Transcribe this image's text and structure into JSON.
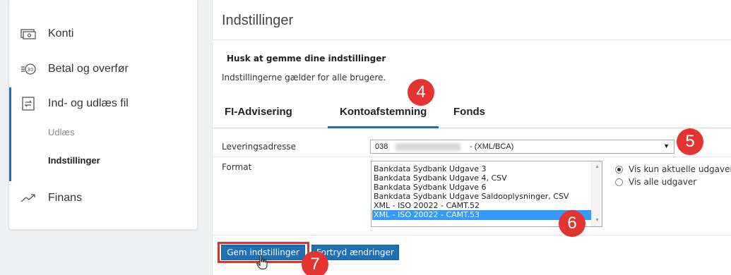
{
  "sidebar": {
    "items": [
      {
        "label": "Konti",
        "icon": "cash-icon"
      },
      {
        "label": "Betal og overfør",
        "icon": "coin-transfer-icon"
      },
      {
        "label": "Ind- og udlæs fil",
        "icon": "file-exchange-icon"
      },
      {
        "label": "Finans",
        "icon": "trend-icon"
      }
    ],
    "subitems": [
      {
        "label": "Udlæs"
      },
      {
        "label": "Indstillinger"
      }
    ]
  },
  "main": {
    "title": "Indstillinger",
    "notice_heading": "Husk at gemme dine indstillinger",
    "notice_text": "Indstillingerne gælder for alle brugere.",
    "tabs": [
      {
        "label": "FI-Advisering"
      },
      {
        "label": "Kontoafstemning"
      },
      {
        "label": "Fonds"
      }
    ],
    "form": {
      "delivery_label": "Leveringsadresse",
      "delivery_value_prefix": "038",
      "delivery_value_suffix": "- (XML/BCA)",
      "format_label": "Format",
      "format_options": [
        "Bankdata Sydbank Udgave 3",
        "Bankdata Sydbank Udgave 4, CSV",
        "Bankdata Sydbank Udgave 6",
        "Bankdata Sydbank Udgave Saldooplysninger, CSV",
        "XML - ISO 20022 - CAMT.52",
        "XML - ISO 20022 - CAMT.53"
      ],
      "selected_format": "XML - ISO 20022 - CAMT.53",
      "radio_current": "Vis kun aktuelle udgaver",
      "radio_all": "Vis alle udgaver"
    },
    "buttons": {
      "save": "Gem indstillinger",
      "cancel": "Fortryd ændringer"
    }
  },
  "markers": [
    "4",
    "5",
    "6",
    "7"
  ],
  "colors": {
    "accent": "#1f6fb5",
    "marker": "#e3342f",
    "selection": "#3399ff"
  }
}
